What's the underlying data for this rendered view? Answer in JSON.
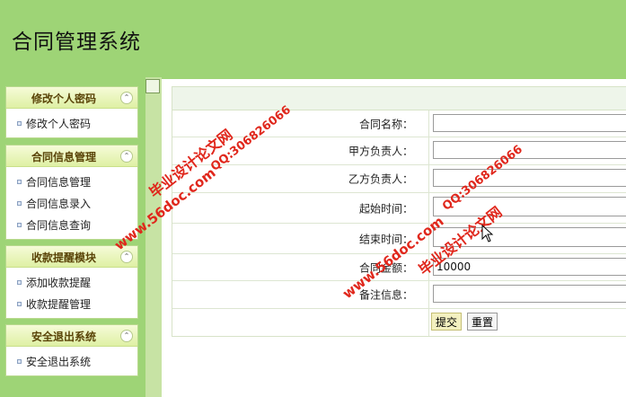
{
  "header": {
    "title": "合同管理系统"
  },
  "sidebar": {
    "panels": [
      {
        "title": "修改个人密码",
        "items": [
          "修改个人密码"
        ]
      },
      {
        "title": "合同信息管理",
        "items": [
          "合同信息管理",
          "合同信息录入",
          "合同信息查询"
        ]
      },
      {
        "title": "收款提醒模块",
        "items": [
          "添加收款提醒",
          "收款提醒管理"
        ]
      },
      {
        "title": "安全退出系统",
        "items": [
          "安全退出系统"
        ]
      }
    ],
    "collapse_glyph": "⌃"
  },
  "form": {
    "fields": {
      "name": {
        "label": "合同名称：",
        "value": ""
      },
      "party_a": {
        "label": "甲方负责人：",
        "value": ""
      },
      "party_b": {
        "label": "乙方负责人：",
        "value": ""
      },
      "start_time": {
        "label": "起始时间：",
        "value": ""
      },
      "end_time": {
        "label": "结束时间：",
        "value": ""
      },
      "amount": {
        "label": "合同金额：",
        "value": "10000"
      },
      "remark": {
        "label": "备注信息：",
        "value": ""
      }
    },
    "buttons": {
      "submit": "提交",
      "reset": "重置"
    }
  },
  "watermarks": {
    "site_a": "www.56doc.com",
    "title_a": "毕业设计论文网",
    "qq_a": "QQ:306826066",
    "site_b": "www.56doc.com",
    "title_b": "毕业设计论文网",
    "qq_b": "QQ:306826066"
  },
  "colors": {
    "page_bg": "#9ed476",
    "watermark": "#e0271c",
    "panel_title": "#5a4408"
  }
}
